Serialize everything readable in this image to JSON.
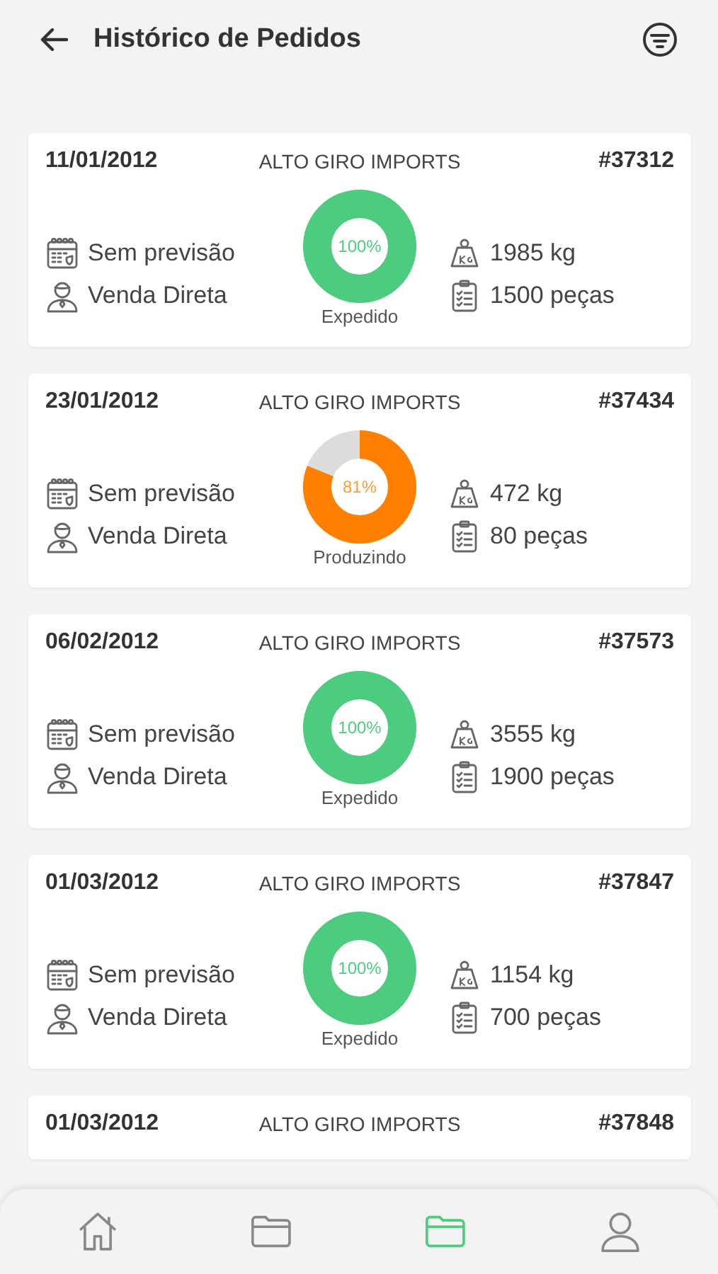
{
  "header": {
    "title": "Histórico de Pedidos"
  },
  "orders": [
    {
      "date": "11/01/2012",
      "client": "ALTO GIRO IMPORTS",
      "number": "#37312",
      "forecast": "Sem previsão",
      "channel": "Venda Direta",
      "weight": "1985 kg",
      "pieces": "1500 peças",
      "status": {
        "kind": "shipped",
        "level": 1,
        "percent": "100%",
        "label": "Expedido"
      }
    },
    {
      "date": "23/01/2012",
      "client": "ALTO GIRO IMPORTS",
      "number": "#37434",
      "forecast": "Sem previsão",
      "channel": "Venda Direta",
      "weight": "472 kg",
      "pieces": "80 peças",
      "status": {
        "kind": "producing",
        "level": 0.81,
        "percent": "81%",
        "label": "Produzindo"
      }
    },
    {
      "date": "06/02/2012",
      "client": "ALTO GIRO IMPORTS",
      "number": "#37573",
      "forecast": "Sem previsão",
      "channel": "Venda Direta",
      "weight": "3555 kg",
      "pieces": "1900 peças",
      "status": {
        "kind": "shipped",
        "level": 1,
        "percent": "100%",
        "label": "Expedido"
      }
    },
    {
      "date": "01/03/2012",
      "client": "ALTO GIRO IMPORTS",
      "number": "#37847",
      "forecast": "Sem previsão",
      "channel": "Venda Direta",
      "weight": "1154 kg",
      "pieces": "700 peças",
      "status": {
        "kind": "shipped",
        "level": 1,
        "percent": "100%",
        "label": "Expedido"
      }
    },
    {
      "date": "01/03/2012",
      "client": "ALTO GIRO IMPORTS",
      "number": "#37848"
    }
  ],
  "bottom_nav": [
    {
      "kind": "home",
      "selected": false
    },
    {
      "kind": "folder",
      "selected": false
    },
    {
      "kind": "folder",
      "selected": true
    },
    {
      "kind": "user",
      "selected": false
    }
  ]
}
